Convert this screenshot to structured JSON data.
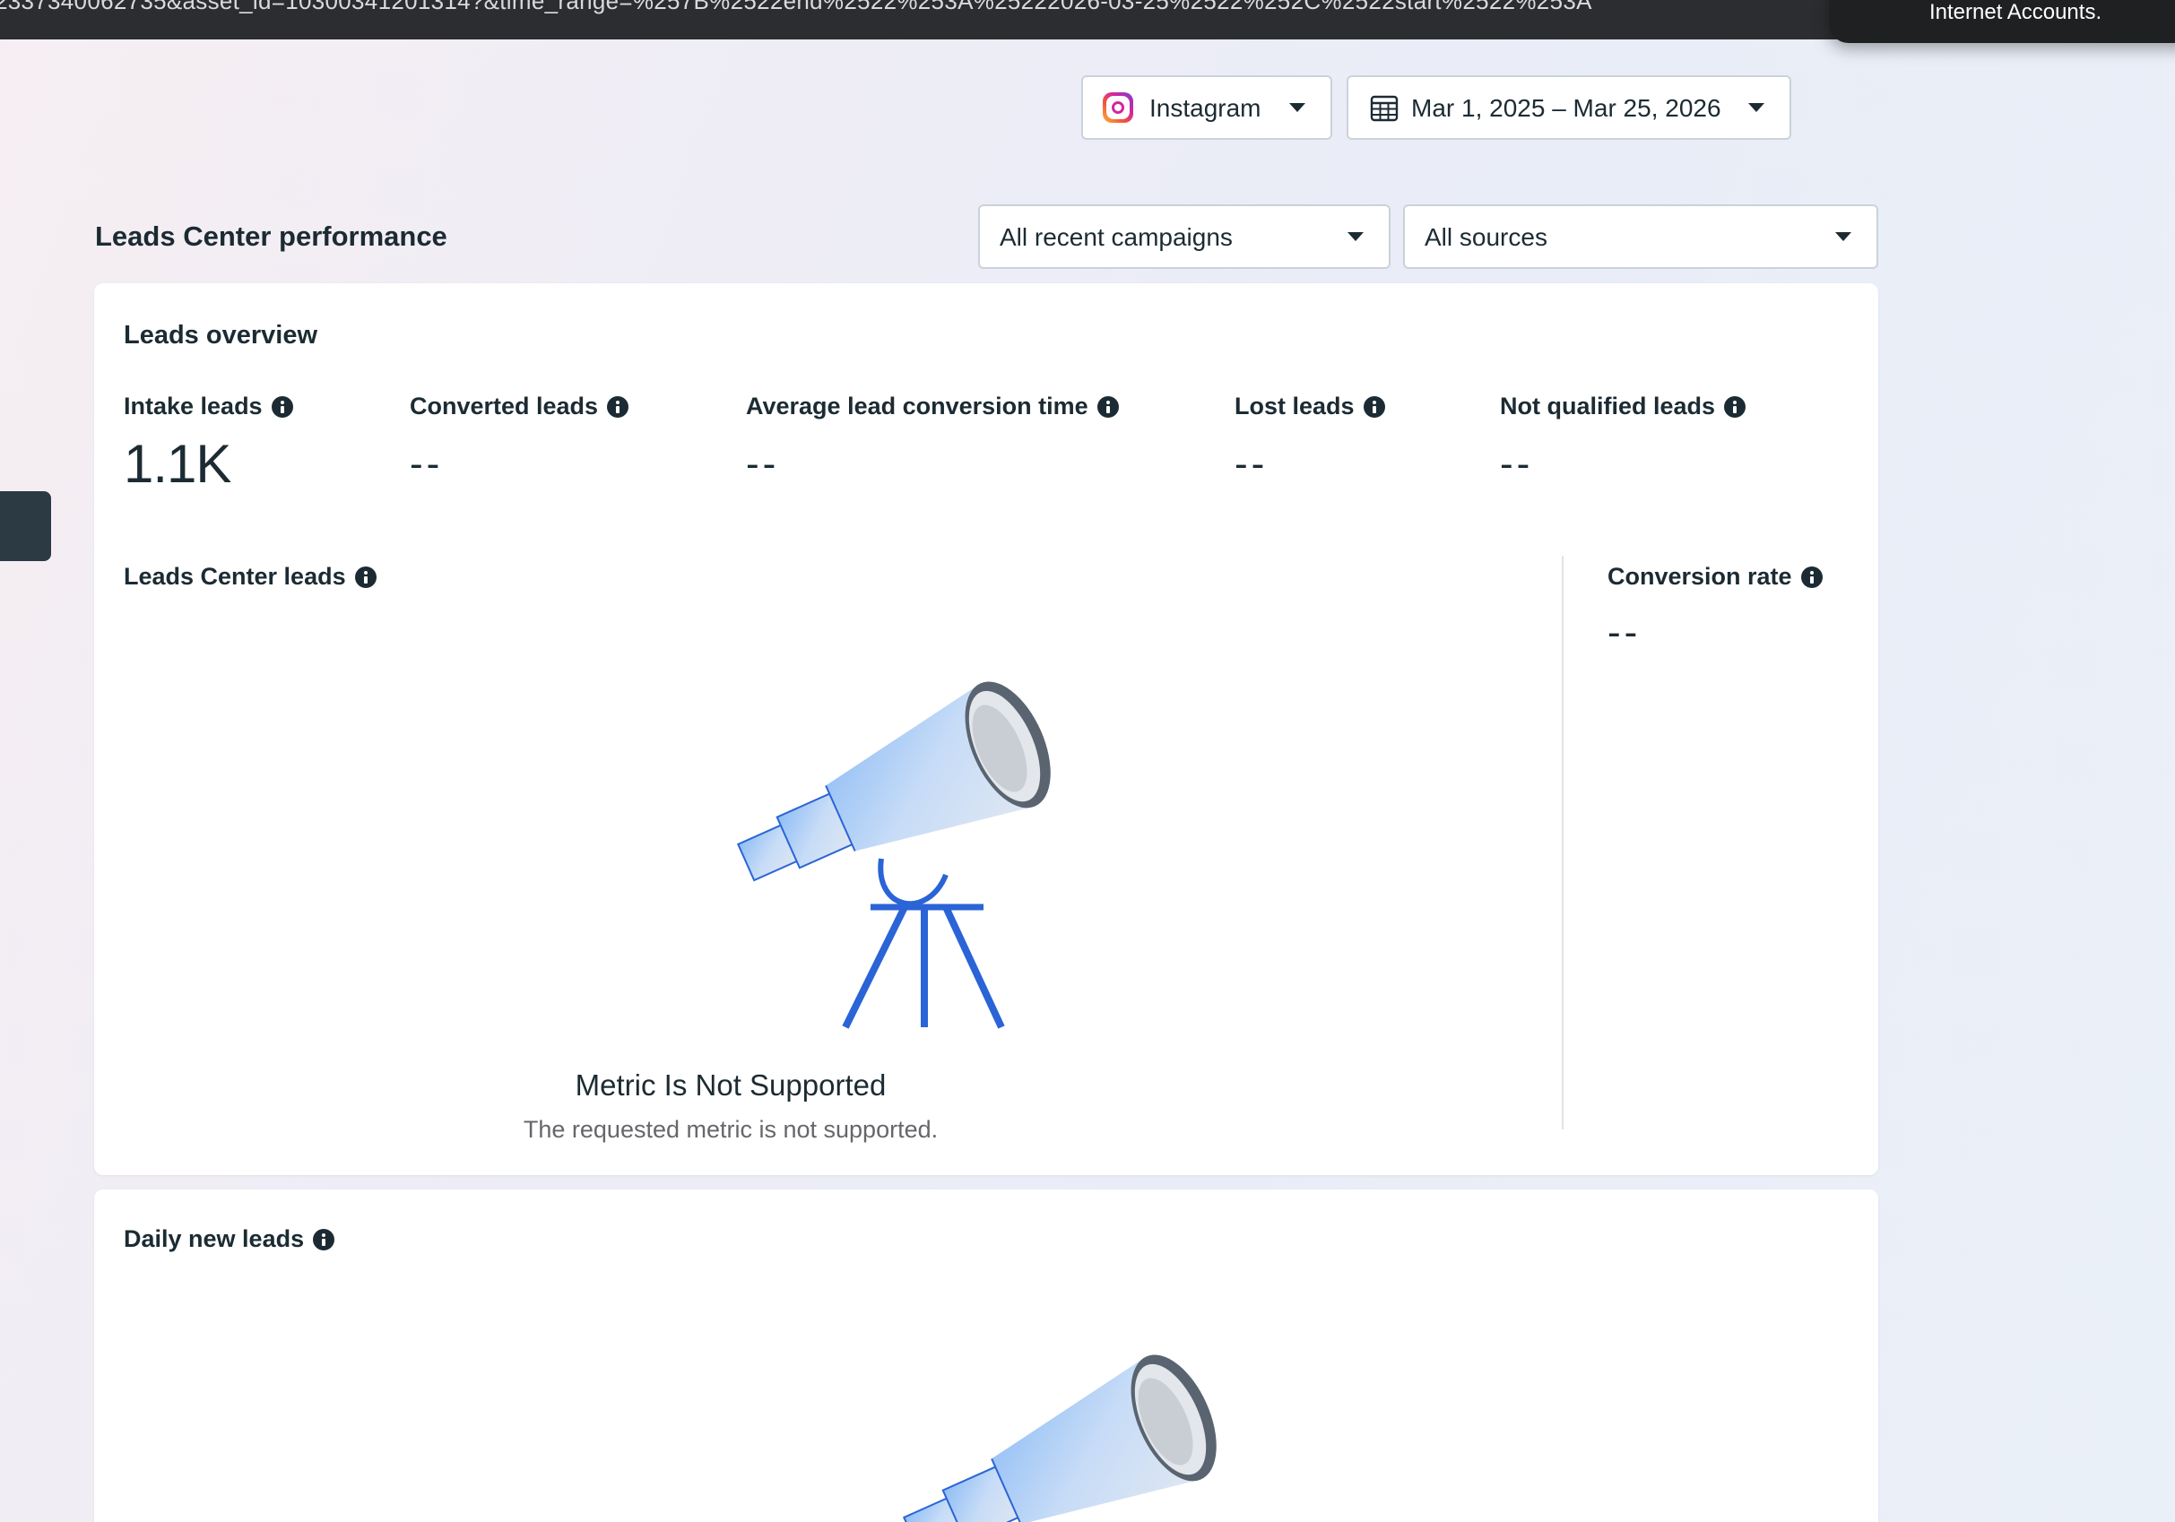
{
  "browser": {
    "url_fragment": "2337340062735&asset_id=10300341201314?&time_range=%257B%2522end%2522%253A%25222026-03-25%2522%252C%2522start%2522%253A",
    "notification_text": "Internet Accounts."
  },
  "filters": {
    "platform": "Instagram",
    "date_range": "Mar 1, 2025 – Mar 25, 2026",
    "campaigns": "All recent campaigns",
    "sources": "All sources"
  },
  "section": {
    "title": "Leads Center performance"
  },
  "overview": {
    "title": "Leads overview",
    "metrics": [
      {
        "label": "Intake leads",
        "value": "1.1K"
      },
      {
        "label": "Converted leads",
        "value": "--"
      },
      {
        "label": "Average lead conversion time",
        "value": "--"
      },
      {
        "label": "Lost leads",
        "value": "--"
      },
      {
        "label": "Not qualified leads",
        "value": "--"
      }
    ],
    "leads_chart": {
      "title": "Leads Center leads",
      "empty_title": "Metric Is Not Supported",
      "empty_subtitle": "The requested metric is not supported."
    },
    "conversion_rate": {
      "label": "Conversion rate",
      "value": "--"
    }
  },
  "daily": {
    "title": "Daily new leads"
  },
  "colors": {
    "accent_blue": "#2a64d6",
    "text": "#1c2b33",
    "muted": "#65676b"
  }
}
